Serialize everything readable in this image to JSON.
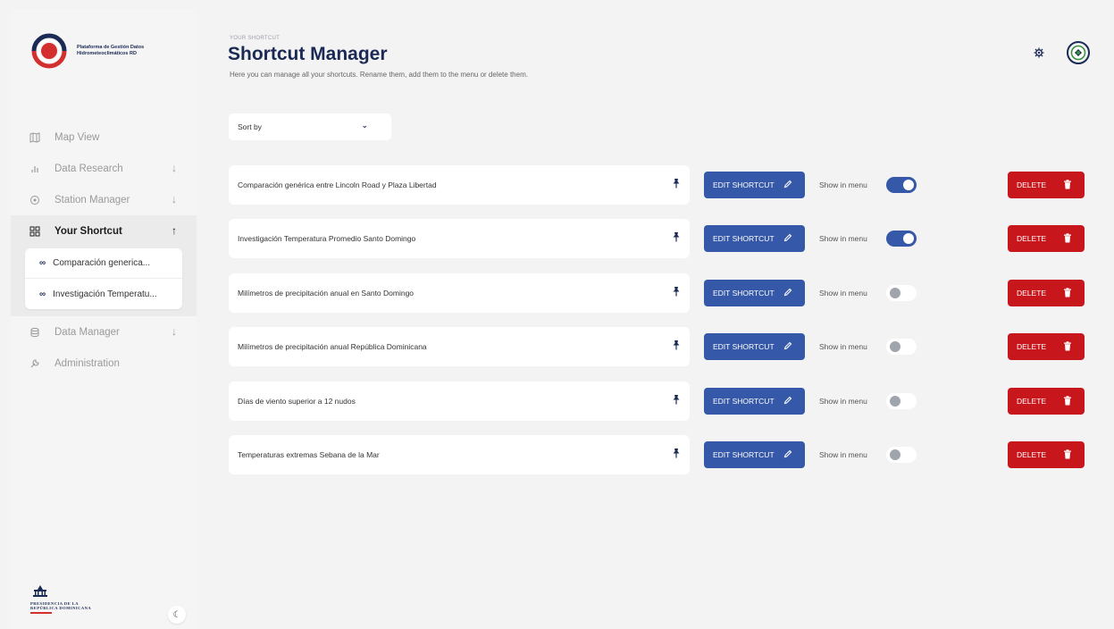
{
  "brand": {
    "name": "Plataforma de Gestión Datos Hidrometeoclimáticos RD",
    "footer_logo_text": "PRESIDENCIA DE LA REPÚBLICA DOMINICANA"
  },
  "sidebar": {
    "items": [
      {
        "label": "Map View",
        "icon": "map-icon",
        "arrow": ""
      },
      {
        "label": "Data Research",
        "icon": "bar-chart-icon",
        "arrow": "↓"
      },
      {
        "label": "Station Manager",
        "icon": "location-pin-icon",
        "arrow": "↓"
      },
      {
        "label": "Your Shortcut",
        "icon": "grid-icon",
        "arrow": "↑",
        "active": true
      },
      {
        "label": "Data Manager",
        "icon": "database-icon",
        "arrow": "↓"
      },
      {
        "label": "Administration",
        "icon": "wrench-icon",
        "arrow": ""
      }
    ],
    "shortcuts": [
      {
        "label": "Comparación generica...",
        "icon": "link-icon"
      },
      {
        "label": "Investigación Temperatu...",
        "icon": "link-icon"
      }
    ]
  },
  "header": {
    "kicker": "YOUR SHORTCUT",
    "title": "Shortcut Manager",
    "subtitle": "Here you can manage all your shortcuts. Rename them, add them to the menu or delete them."
  },
  "sort": {
    "label": "Sort by",
    "icon": "chevron-down-icon"
  },
  "labels": {
    "edit": "EDIT SHORTCUT",
    "show": "Show in menu",
    "delete": "DELETE"
  },
  "shortcuts": [
    {
      "name": "Comparación genérica entre Lincoln Road y Plaza Libertad",
      "show_in_menu": true
    },
    {
      "name": "Investigación Temperatura Promedio Santo Domingo",
      "show_in_menu": true
    },
    {
      "name": "Milímetros de precipitación anual en Santo Domingo",
      "show_in_menu": false
    },
    {
      "name": "Milímetros de precipitación anual República Dominicana",
      "show_in_menu": false
    },
    {
      "name": "Días de viento superior a 12 nudos",
      "show_in_menu": false
    },
    {
      "name": "Temperaturas extremas Sebana de la Mar",
      "show_in_menu": false
    }
  ],
  "colors": {
    "primary": "#3558a8",
    "danger": "#c8161d",
    "brand_navy": "#1b2a55",
    "background": "#f3f3f4"
  }
}
